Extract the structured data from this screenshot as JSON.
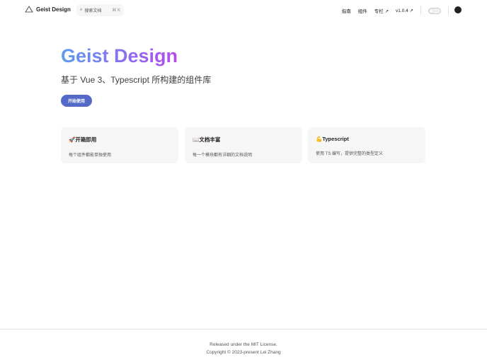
{
  "nav": {
    "brand": "Geist Design",
    "search_placeholder": "搜索文档",
    "search_shortcut": "⌘ K",
    "links": [
      "指南",
      "组件",
      "专栏 ↗",
      "v1.0.4 ↗"
    ]
  },
  "hero": {
    "title": "Geist Design",
    "tagline": "基于 Vue 3、Typescript 所构建的组件库",
    "cta": "开始使用"
  },
  "features": [
    {
      "title": "🚀开箱即用",
      "desc": "每个组件都能单独使用"
    },
    {
      "title": "📖文档丰富",
      "desc": "每一个模块都有详细的文档说明"
    },
    {
      "title": "💪Typescript",
      "desc": "使用 TS 编写，提供完整的类型定义"
    }
  ],
  "footer": {
    "license": "Released under the MIT License.",
    "copyright": "Copyright © 2023-present Lei Zhang"
  }
}
